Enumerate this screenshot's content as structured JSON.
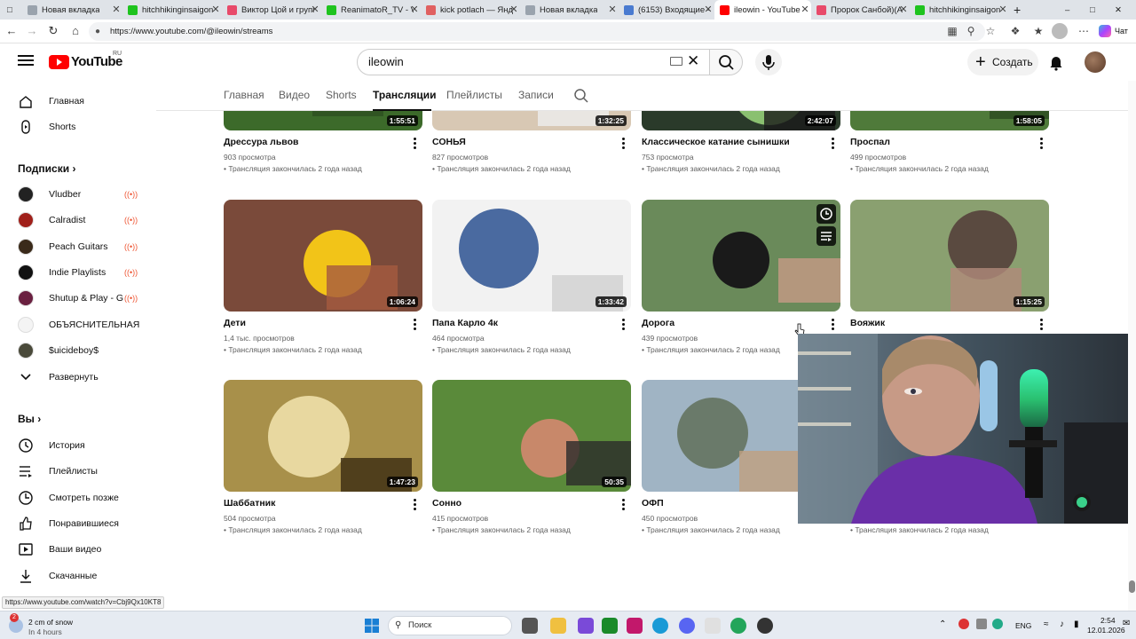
{
  "browser": {
    "tabs": [
      {
        "title": "Новая вкладка",
        "icon": "page-icon",
        "color": "#9aa3ad"
      },
      {
        "title": "hitchhikinginsaigon",
        "icon": "kick-icon",
        "color": "#1ec31e"
      },
      {
        "title": "Виктор Цой и группа",
        "icon": "vk-video-icon",
        "color": "#e84a6a"
      },
      {
        "title": "ReanimatoR_TV - Vi",
        "icon": "kick-icon",
        "color": "#1ec31e"
      },
      {
        "title": "kick potlach — Янд",
        "icon": "yandex-icon",
        "color": "#e06060"
      },
      {
        "title": "Новая вкладка",
        "icon": "page-icon",
        "color": "#9aa3ad"
      },
      {
        "title": "(6153) Входящие -",
        "icon": "mail-icon",
        "color": "#4a7bd0"
      },
      {
        "title": "ileowin - YouTube",
        "icon": "youtube-icon",
        "color": "#ff0000",
        "active": true
      },
      {
        "title": "Пророк Санбой)(A",
        "icon": "vk-video-icon",
        "color": "#e84a6a"
      },
      {
        "title": "hitchhikinginsaigon",
        "icon": "kick-icon",
        "color": "#1ec31e"
      }
    ],
    "url": "https://www.youtube.com/@ileowin/streams",
    "chat_label": "Чат"
  },
  "header": {
    "logo_text": "YouTube",
    "country": "RU",
    "search_value": "ileowin",
    "create_label": "Создать"
  },
  "sidebar": {
    "main": [
      {
        "label": "Главная",
        "icon": "home-icon"
      },
      {
        "label": "Shorts",
        "icon": "shorts-icon"
      }
    ],
    "subs_title": "Подписки",
    "subs": [
      {
        "label": "Vludber",
        "color": "#222",
        "live": true
      },
      {
        "label": "Calradist",
        "color": "#a0201a",
        "live": true
      },
      {
        "label": "Peach Guitars",
        "color": "#3a2a1a",
        "live": true
      },
      {
        "label": "Indie Playlists",
        "color": "#111",
        "live": true
      },
      {
        "label": "Shutup & Play - G",
        "color": "#6a2040",
        "live": true
      },
      {
        "label": "ОБЪЯСНИТЕЛЬНАЯ",
        "color": "#f4f4f4",
        "live": false
      },
      {
        "label": "$uicideboy$",
        "color": "#4a4a3a",
        "live": false
      }
    ],
    "expand_label": "Развернуть",
    "you_title": "Вы",
    "you_items": [
      {
        "label": "История",
        "icon": "history-icon"
      },
      {
        "label": "Плейлисты",
        "icon": "playlists-icon"
      },
      {
        "label": "Смотреть позже",
        "icon": "watch-later-icon"
      },
      {
        "label": "Понравившиеся",
        "icon": "like-icon"
      },
      {
        "label": "Ваши видео",
        "icon": "your-videos-icon"
      },
      {
        "label": "Скачанные",
        "icon": "download-icon"
      }
    ]
  },
  "channel_tabs": [
    "Главная",
    "Видео",
    "Shorts",
    "Трансляции",
    "Плейлисты",
    "Записи"
  ],
  "active_tab": "Трансляции",
  "videos": [
    {
      "title": "Дрессура львов",
      "views": "903 просмотра",
      "ago": "• Трансляция закончилась 2 года назад",
      "duration": "1:55:51"
    },
    {
      "title": "СОНЬЯ",
      "views": "827 просмотров",
      "ago": "• Трансляция закончилась 2 года назад",
      "duration": "1:32:25"
    },
    {
      "title": "Классическое катание сынишки",
      "views": "753 просмотра",
      "ago": "• Трансляция закончилась 2 года назад",
      "duration": "2:42:07"
    },
    {
      "title": "Проспал",
      "views": "499 просмотров",
      "ago": "• Трансляция закончилась 2 года назад",
      "duration": "1:58:05"
    },
    {
      "title": "Дети",
      "views": "1,4 тыс. просмотров",
      "ago": "• Трансляция закончилась 2 года назад",
      "duration": "1:06:24"
    },
    {
      "title": "Папа Карло 4к",
      "views": "464 просмотра",
      "ago": "• Трансляция закончилась 2 года назад",
      "duration": "1:33:42"
    },
    {
      "title": "Дорога",
      "views": "439 просмотров",
      "ago": "• Трансляция закончилась 2 года назад",
      "duration": ""
    },
    {
      "title": "Вояжик",
      "views": "",
      "ago": "",
      "duration": "1:15:25"
    },
    {
      "title": "Шаббатник",
      "views": "504 просмотра",
      "ago": "• Трансляция закончилась 2 года назад",
      "duration": "1:47:23"
    },
    {
      "title": "Сонно",
      "views": "415 просмотров",
      "ago": "• Трансляция закончилась 2 года назад",
      "duration": "50:35"
    },
    {
      "title": "ОФП",
      "views": "450 просмотров",
      "ago": "• Трансляция закончилась 2 года назад",
      "duration": ""
    },
    {
      "title": "",
      "views": "",
      "ago": "• Трансляция закончилась 2 года назад",
      "duration": ""
    }
  ],
  "hover_link": "https://www.youtube.com/watch?v=Cbj9Qx10KT8",
  "taskbar": {
    "weather_temp": "2 cm of snow",
    "weather_sub": "In 4 hours",
    "search_placeholder": "Поиск",
    "lang": "ENG",
    "time": "2:54",
    "date": "12.01.2026",
    "notif_count": "2"
  }
}
